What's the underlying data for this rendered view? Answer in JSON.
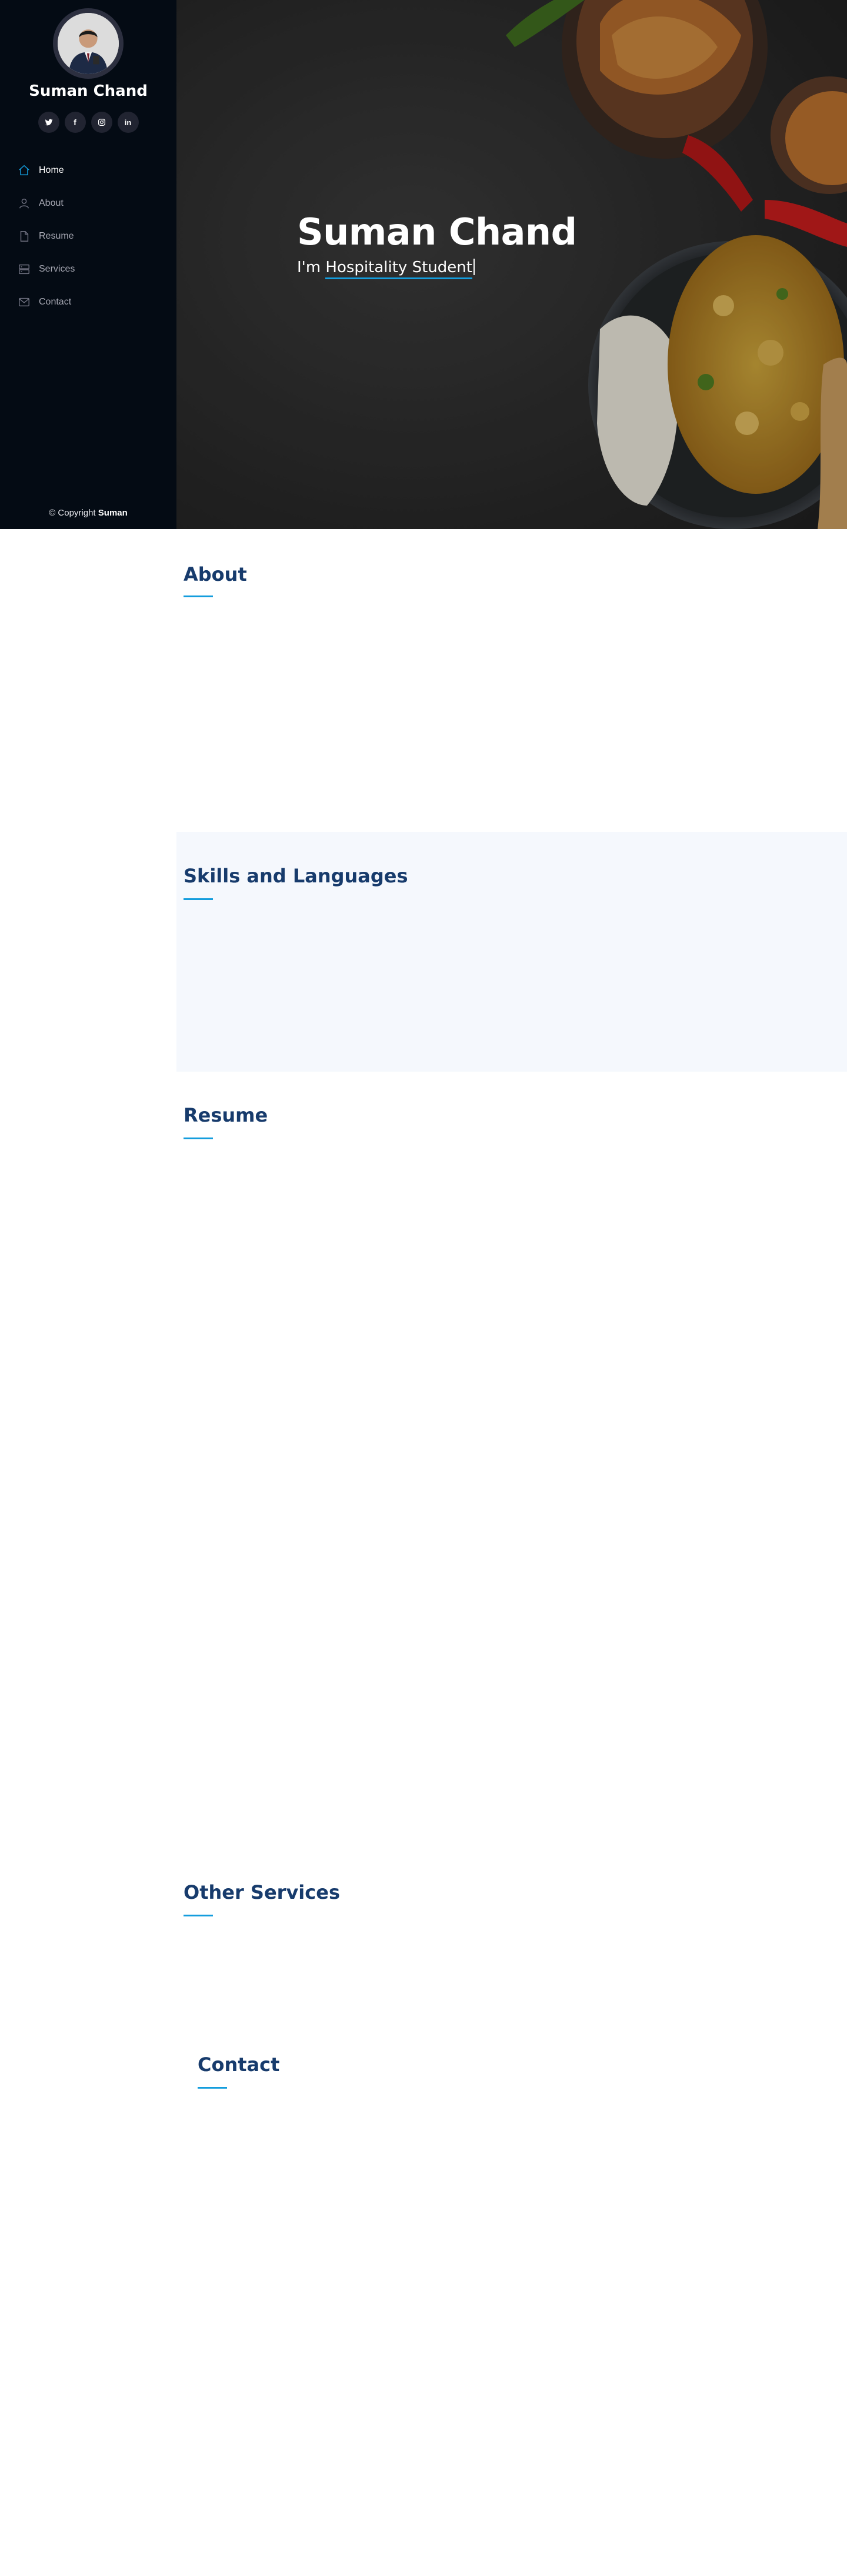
{
  "profile": {
    "name": "Suman Chand"
  },
  "social": [
    {
      "icon": "twitter-icon"
    },
    {
      "icon": "facebook-icon",
      "glyph": "f"
    },
    {
      "icon": "instagram-icon"
    },
    {
      "icon": "linkedin-icon",
      "glyph": "in"
    }
  ],
  "nav": {
    "items": [
      {
        "label": "Home",
        "icon": "home-icon",
        "active": true
      },
      {
        "label": "About",
        "icon": "person-icon"
      },
      {
        "label": "Resume",
        "icon": "file-icon"
      },
      {
        "label": "Services",
        "icon": "server-icon"
      },
      {
        "label": "Contact",
        "icon": "envelope-icon"
      }
    ]
  },
  "footer": {
    "copyright_prefix": "© Copyright",
    "copyright_name": "Suman"
  },
  "hero": {
    "title": "Suman Chand",
    "sub_prefix": "I'm ",
    "sub_typed": "Hospitality Student"
  },
  "sections": {
    "about": "About",
    "skills": "Skills and Languages",
    "resume": "Resume",
    "services": "Other Services",
    "contact": "Contact"
  },
  "colors": {
    "sidebar_bg": "#040b14",
    "accent": "#149ddd",
    "heading": "#173b6c",
    "alt_section_bg": "#f5f8fd"
  }
}
